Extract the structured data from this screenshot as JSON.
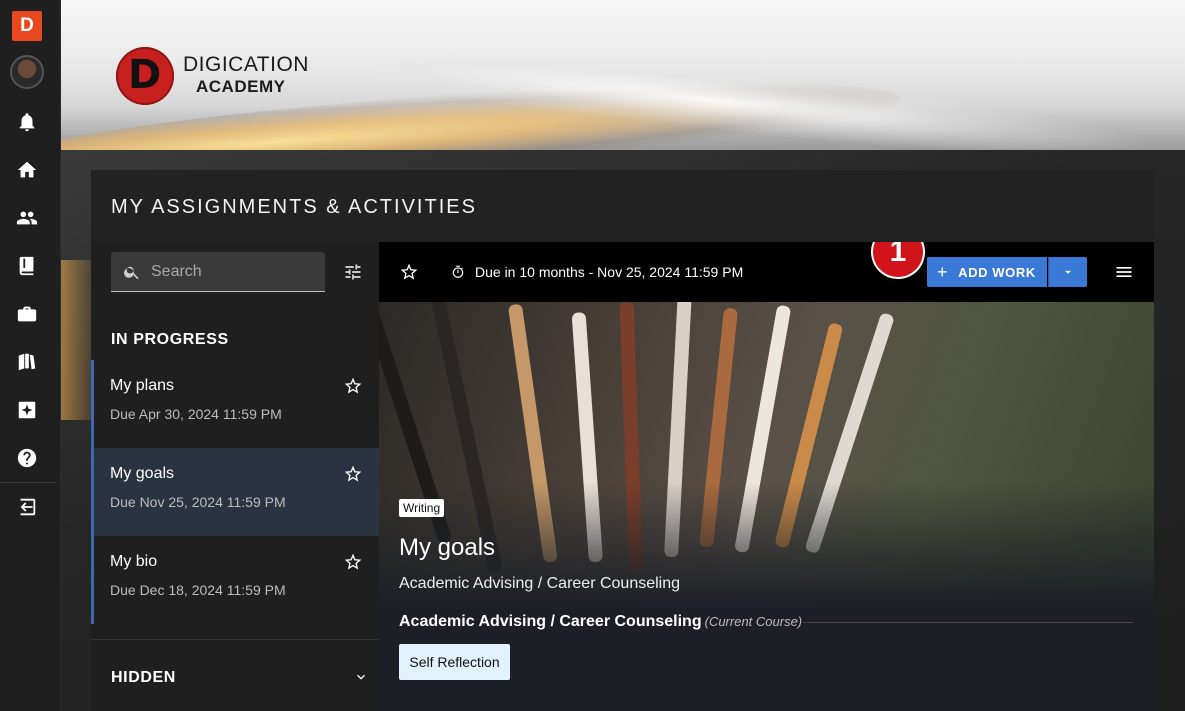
{
  "app": {
    "logo_letter": "D",
    "brand_line1": "DIGICATION",
    "brand_line2": "ACADEMY",
    "brand_mark_letter": "D"
  },
  "panel": {
    "title": "MY ASSIGNMENTS & ACTIVITIES"
  },
  "search": {
    "placeholder": "Search"
  },
  "in_progress": {
    "label": "IN PROGRESS",
    "items": [
      {
        "name": "My plans",
        "due": "Due Apr 30, 2024 11:59 PM"
      },
      {
        "name": "My goals",
        "due": "Due Nov 25, 2024 11:59 PM"
      },
      {
        "name": "My bio",
        "due": "Due Dec 18, 2024 11:59 PM"
      }
    ]
  },
  "hidden": {
    "label": "HIDDEN"
  },
  "toolbar": {
    "due_text": "Due in 10 months - Nov 25, 2024 11:59 PM",
    "add_work_label": "ADD WORK",
    "annotation_number": "1"
  },
  "work": {
    "tag": "Writing",
    "title": "My goals",
    "subtitle": "Academic Advising / Career Counseling",
    "course_name": "Academic Advising / Career Counseling",
    "course_note": "(Current Course)",
    "chip": "Self Reflection"
  },
  "colors": {
    "accent": "#3b79d6",
    "brand_red": "#c8201e",
    "logo_orange": "#e8481f",
    "selected_row": "#2b3340",
    "annotation_red": "#d0141a"
  }
}
